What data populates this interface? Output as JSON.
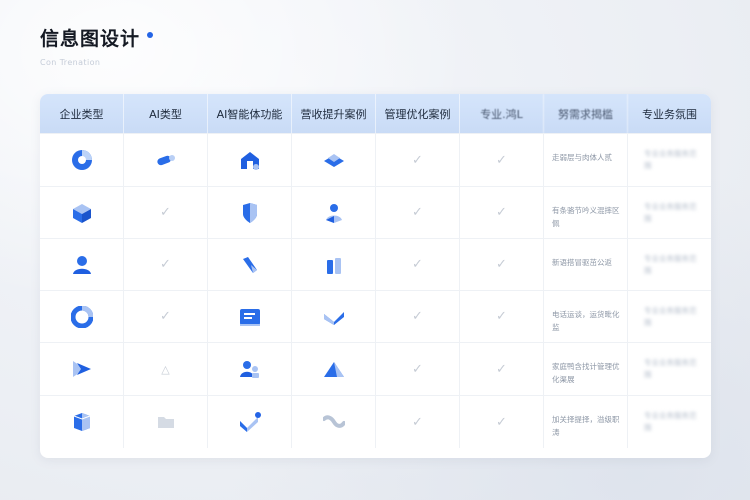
{
  "header": {
    "title": "信息图设计",
    "subtitle": "Con Trenation"
  },
  "table": {
    "columns": [
      "企业类型",
      "AI类型",
      "AI智能体功能",
      "营收提升案例",
      "管理优化案例",
      "专业.鸿L",
      "努需求揭槛",
      "专业务氛围"
    ],
    "rows": [
      {
        "enterprise_icon": "pie-chart-icon",
        "ai_type": {
          "kind": "icon",
          "value": "toggle-dot-icon"
        },
        "agent_icon": "robot-house-icon",
        "revenue_icon": "diamond-layers-icon",
        "management": "check",
        "professional": "check",
        "demand_text": "走弱层与肉体人贰",
        "blurred_text": "专业业务服务范围"
      },
      {
        "enterprise_icon": "cube-icon",
        "ai_type": {
          "kind": "check",
          "value": ""
        },
        "agent_icon": "shield-icon",
        "revenue_icon": "user-growth-icon",
        "management": "check",
        "professional": "check",
        "demand_text": "有条骆节吟义混摔区佩",
        "blurred_text": "专业业务服务范围"
      },
      {
        "enterprise_icon": "user-icon",
        "ai_type": {
          "kind": "check",
          "value": ""
        },
        "agent_icon": "pen-icon",
        "revenue_icon": "chart-bars-icon",
        "management": "check",
        "professional": "check",
        "demand_text": "新语搭冒驱茁公返",
        "blurred_text": "专业业务服务范围"
      },
      {
        "enterprise_icon": "ring-icon",
        "ai_type": {
          "kind": "check",
          "value": ""
        },
        "agent_icon": "document-icon",
        "revenue_icon": "chevron-down-icon",
        "management": "check",
        "professional": "check",
        "demand_text": "电话运谈，运货毗化监",
        "blurred_text": "专业业务服务范围"
      },
      {
        "enterprise_icon": "share-icon",
        "ai_type": {
          "kind": "triangle",
          "value": "△"
        },
        "agent_icon": "team-icon",
        "revenue_icon": "mountain-icon",
        "management": "check",
        "professional": "check",
        "demand_text": "家庭鸭含找计管理优化渠展",
        "blurred_text": "专业业务服务范围"
      },
      {
        "enterprise_icon": "box-icon",
        "ai_type": {
          "kind": "icon",
          "value": "folder-icon"
        },
        "agent_icon": "check-badge-icon",
        "revenue_icon": "wave-icon",
        "management": "check",
        "professional": "check",
        "demand_text": "加关择提择，溢级职涛",
        "blurred_text": "专业业务服务范围"
      }
    ]
  },
  "colors": {
    "accent": "#2464e6",
    "header_bg": "#d1e2fa",
    "check": "#c6ccd5"
  }
}
